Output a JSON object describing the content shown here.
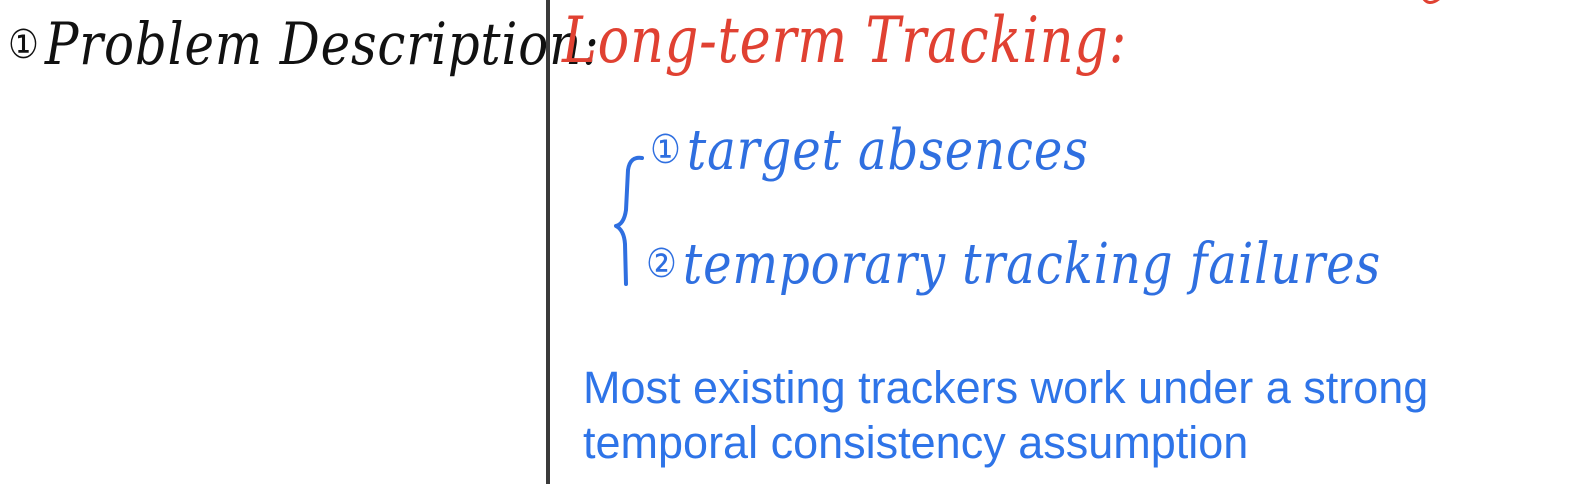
{
  "heading": {
    "number": "①",
    "label": "Problem Description:"
  },
  "topic": {
    "title": "Long-term Tracking:"
  },
  "points": [
    {
      "number": "①",
      "text": "target absences"
    },
    {
      "number": "②",
      "text": "temporary tracking failures"
    }
  ],
  "statement": {
    "line1": "Most existing trackers work under a strong",
    "line2": "temporal consistency assumption"
  },
  "colors": {
    "heading": "#111111",
    "topic": "#e04132",
    "points": "#2f6fe0",
    "statement": "#2e74e8",
    "divider": "#3a3a3a"
  }
}
